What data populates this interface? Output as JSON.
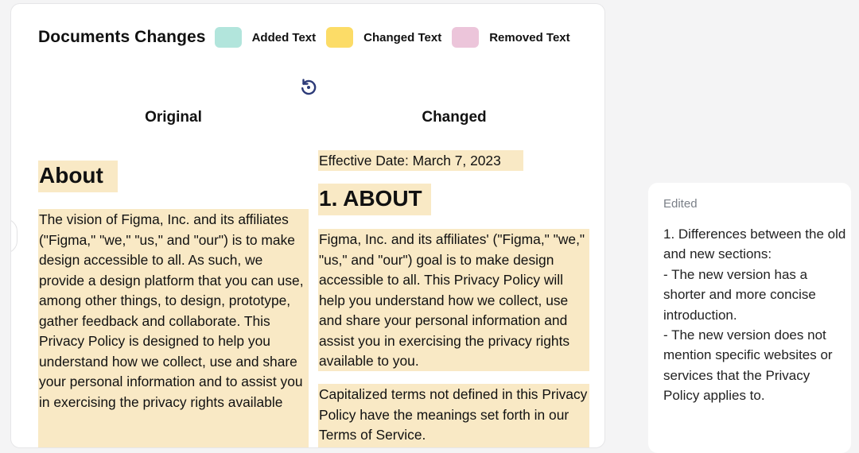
{
  "legend": {
    "title": "Documents Changes",
    "added_label": "Added Text",
    "changed_label": "Changed Text",
    "removed_label": "Removed Text",
    "added_color": "#b2e5dc",
    "changed_color": "#fcdc67",
    "removed_color": "#ecc5da"
  },
  "toolbar": {
    "undo_icon": "undo-icon"
  },
  "columns": {
    "original_label": "Original",
    "changed_label": "Changed"
  },
  "original": {
    "heading": "About",
    "paragraph": "The vision of Figma, Inc. and its affiliates (\"Figma,\" \"we,\" \"us,\" and \"our\") is to make design accessible to all. As such, we provide a design platform that you can use, among other things, to design, prototype, gather feedback and collaborate. This Privacy Policy is designed to help you understand how we collect, use and share your personal information and to assist you in exercising the privacy rights available"
  },
  "changed": {
    "effective_date": "Effective Date: March 7, 2023",
    "heading": "1. ABOUT",
    "paragraph1": "Figma, Inc. and its affiliates' (\"Figma,\" \"we,\" \"us,\" and \"our\") goal is to make design accessible to all. This Privacy Policy will help you understand how we collect, use and share your personal information and assist you in exercising the privacy rights available to you.",
    "paragraph2": "Capitalized terms not defined in this Privacy Policy have the meanings set forth in our Terms of Service."
  },
  "side_panel": {
    "label": "Edited",
    "text": "1. Differences between the old and new sections:\n- The new version has a shorter and more concise introduction.\n- The new version does not mention specific websites or services that the Privacy Policy applies to."
  }
}
